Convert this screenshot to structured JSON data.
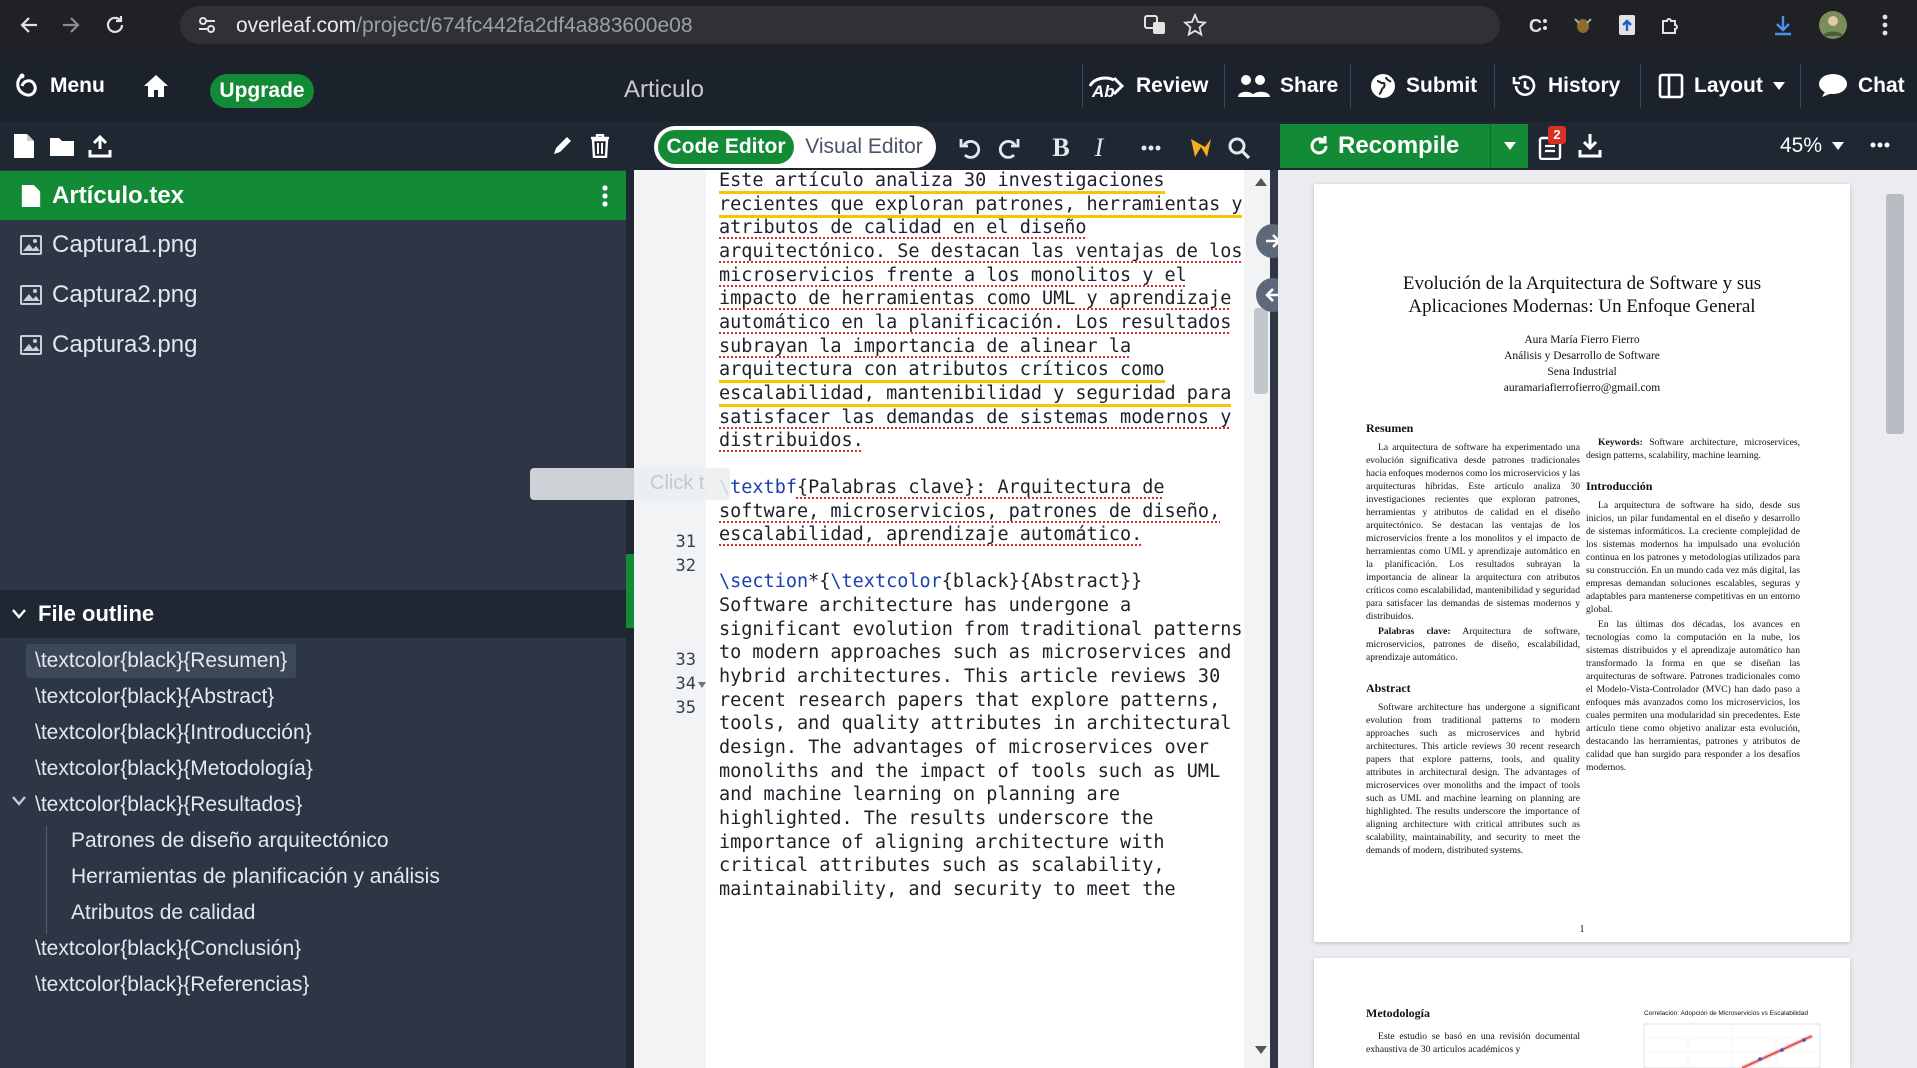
{
  "browser": {
    "url_domain": "overleaf.com",
    "url_path": "/project/674fc442fa2df4a883600e08"
  },
  "toolbar": {
    "menu": "Menu",
    "upgrade": "Upgrade",
    "project_title": "Articulo",
    "review": "Review",
    "share": "Share",
    "submit": "Submit",
    "history": "History",
    "layout": "Layout",
    "chat": "Chat"
  },
  "files": [
    {
      "name": "Artículo.tex",
      "type": "tex",
      "selected": true
    },
    {
      "name": "Captura1.png",
      "type": "image",
      "selected": false
    },
    {
      "name": "Captura2.png",
      "type": "image",
      "selected": false
    },
    {
      "name": "Captura3.png",
      "type": "image",
      "selected": false
    }
  ],
  "outline": {
    "header": "File outline",
    "items": [
      "\\textcolor{black}{Resumen}",
      "\\textcolor{black}{Abstract}",
      "\\textcolor{black}{Introducción}",
      "\\textcolor{black}{Metodología}",
      "\\textcolor{black}{Resultados}",
      "Patrones de diseño arquitectónico",
      "Herramientas de planificación y análisis",
      "Atributos de calidad",
      "\\textcolor{black}{Conclusión}",
      "\\textcolor{black}{Referencias}"
    ]
  },
  "editor": {
    "code_editor": "Code Editor",
    "visual_editor": "Visual Editor",
    "bold": "B",
    "italic": "I",
    "overlay_hint": "Click t",
    "line_numbers": {
      "l31": "31",
      "l32": "32",
      "l33": "33",
      "l34": "34",
      "l35": "35"
    },
    "lines": {
      "a1": "Este artículo analiza 30 investigaciones",
      "a2": "recientes que exploran patrones, herramientas y",
      "a3": "atributos de calidad en el diseño",
      "a4": "arquitectónico. Se destacan las ventajas de los",
      "a5": "microservicios frente a los monolitos y el",
      "a6": "impacto de herramientas como UML y aprendizaje",
      "a7": "automático en la planificación. Los resultados",
      "a8": "subrayan la importancia de alinear la",
      "a9": "arquitectura con atributos críticos como",
      "a10": "escalabilidad, mantenibilidad y seguridad para",
      "a11": "satisfacer las demandas de sistemas modernos y",
      "a12": "distribuidos.",
      "b1_cmd": "\\textbf",
      "b1_rest": "{Palabras clave}: Arquitectura de",
      "b2": "software, microservicios, patrones de diseño,",
      "b3": "escalabilidad, aprendizaje automático.",
      "c1_cmd": "\\section",
      "c1_mid": "*{",
      "c1_cmd2": "\\textcolor",
      "c1_rest": "{black}{Abstract}}",
      "d1": "Software architecture has undergone a",
      "d2": "significant evolution from traditional patterns",
      "d3": "to modern approaches such as microservices and",
      "d4": "hybrid architectures. This article reviews 30",
      "d5": "recent research papers that explore patterns,",
      "d6": "tools, and quality attributes in architectural",
      "d7": "design. The advantages of microservices over",
      "d8": "monoliths and the impact of tools such as UML",
      "d9": "and machine learning on planning are",
      "d10": "highlighted. The results underscore the",
      "d11": "importance of aligning architecture with",
      "d12": "critical attributes such as scalability,",
      "d13": "maintainability, and security to meet the"
    }
  },
  "pdf": {
    "recompile": "Recompile",
    "zoom": "45%",
    "error_count": "2",
    "title_line1": "Evolución de la Arquitectura de Software y sus",
    "title_line2": "Aplicaciones Modernas: Un Enfoque General",
    "author": "Aura María Fierro Fierro",
    "affil1": "Análisis y Desarrollo de Software",
    "affil2": "Sena Industrial",
    "email": "auramariafierrofierro@gmail.com",
    "h_resumen": "Resumen",
    "resumen_text": "La arquitectura de software ha experimentado una evolución significativa desde patrones tradicionales hacia enfoques modernos como los microservicios y las arquitecturas híbridas. Este artículo analiza 30 investigaciones recientes que exploran patrones, herramientas y atributos de calidad en el diseño arquitectónico. Se destacan las ventajas de los microservicios frente a los monolitos y el impacto de herramientas como UML y aprendizaje automático en la planificación. Los resultados subrayan la importancia de alinear la arquitectura con atributos críticos como escalabilidad, mantenibilidad y seguridad para satisfacer las demandas de sistemas modernos y distribuidos.",
    "palabras_label": "Palabras clave:",
    "palabras_text": "Arquitectura de software, microservicios, patrones de diseño, escalabilidad, aprendizaje automático.",
    "h_abstract": "Abstract",
    "abstract_text": "Software architecture has undergone a significant evolution from traditional patterns to modern approaches such as microservices and hybrid architectures. This article reviews 30 recent research papers that explore patterns, tools, and quality attributes in architectural design. The advantages of microservices over monoliths and the impact of tools such as UML and machine learning on planning are highlighted. The results underscore the importance of aligning architecture with critical attributes such as scalability, maintainability, and security to meet the demands of modern, distributed systems.",
    "keywords_label": "Keywords:",
    "keywords_text": "Software architecture, microservices, design patterns, scalability, machine learning.",
    "h_intro": "Introducción",
    "intro_p1": "La arquitectura de software ha sido, desde sus inicios, un pilar fundamental en el diseño y desarrollo de sistemas informáticos. La creciente complejidad de los sistemas modernos ha impulsado una evolución continua en los patrones y metodologías utilizados para su construcción. En un mundo cada vez más digital, las empresas demandan soluciones escalables, seguras y adaptables para mantenerse competitivas en un entorno global.",
    "intro_p2": "En las últimas dos décadas, los avances en tecnologías como la computación en la nube, los sistemas distribuidos y el aprendizaje automático han transformado la forma en que se diseñan las arquitecturas de software. Patrones tradicionales como el Modelo-Vista-Controlador (MVC) han dado paso a enfoques más avanzados como los microservicios, los cuales permiten una modularidad sin precedentes. Este artículo tiene como objetivo analizar esta evolución, destacando las herramientas, patrones y atributos de calidad que han surgido para responder a los desafíos modernos.",
    "page_number": "1",
    "h_metodologia": "Metodología",
    "metodologia_text": "Este estudio se basó en una revisión documental exhaustiva de 30 artículos académicos y",
    "chart_caption": "Correlación: Adopción de Microservicios vs Escalabilidad"
  }
}
